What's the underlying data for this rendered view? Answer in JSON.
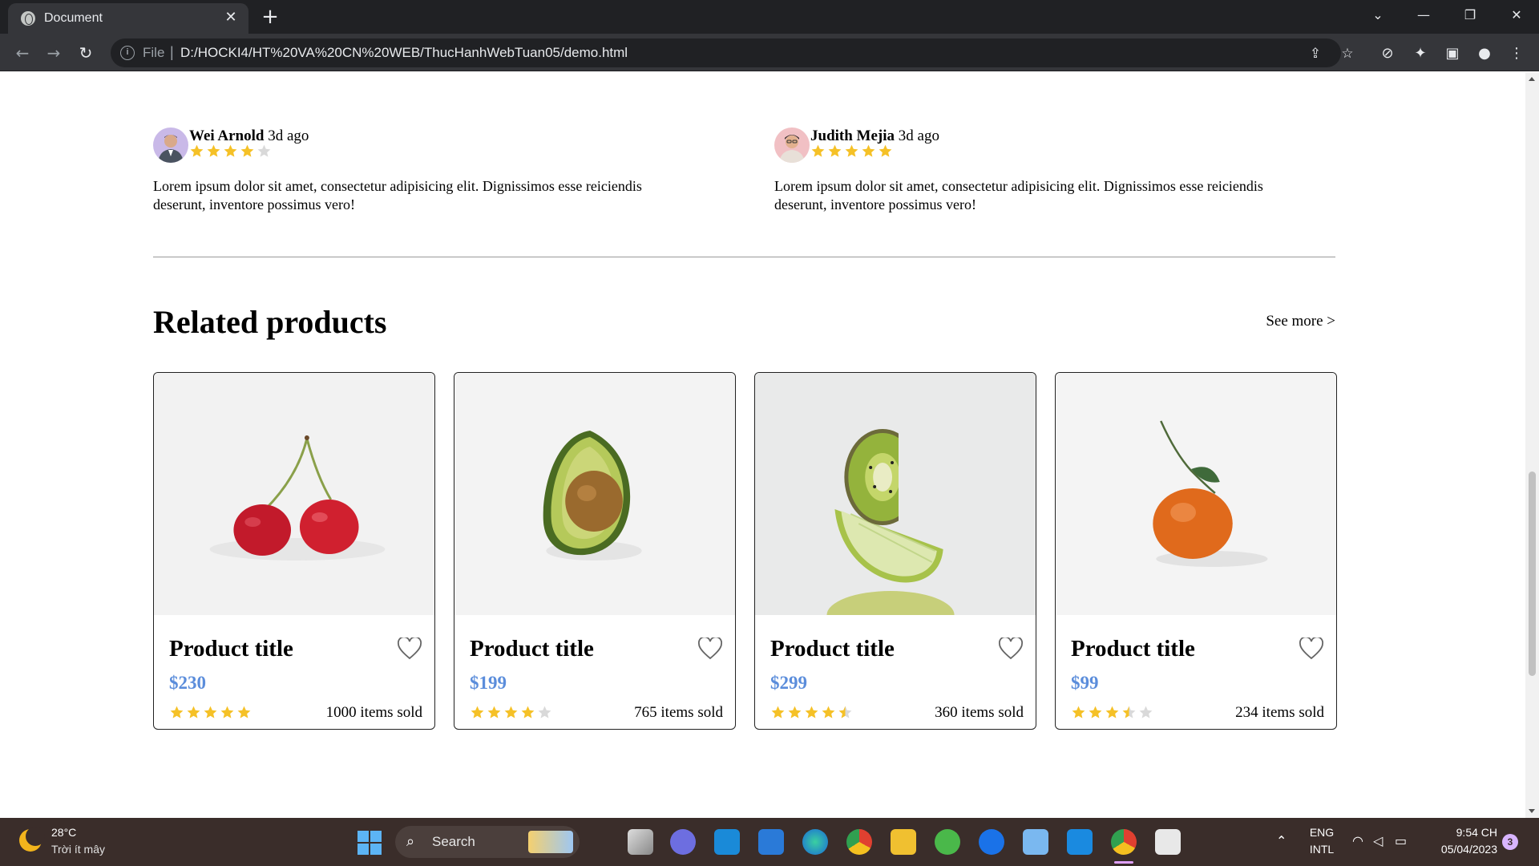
{
  "browser": {
    "tab_title": "Document",
    "tab_close": "✕",
    "new_tab": "+",
    "window_controls": [
      "⌄",
      "—",
      "❐",
      "✕"
    ],
    "nav": {
      "back": "←",
      "forward": "→",
      "reload": "↻"
    },
    "address": {
      "scheme": "File",
      "separator": "|",
      "url": "D:/HOCKI4/HT%20VA%20CN%20WEB/ThucHanhWebTuan05/demo.html",
      "info_icon": "i"
    },
    "toolbar_icons": [
      "share-icon",
      "bookmark-star-icon",
      "compass-icon",
      "extensions-icon",
      "side-panel-icon",
      "profile-icon",
      "menu-icon"
    ]
  },
  "reviews": [
    {
      "name": "Wei Arnold",
      "time": "3d ago",
      "rating": 4,
      "text": "Lorem ipsum dolor sit amet, consectetur adipisicing elit. Dignissimos esse reiciendis deserunt, inventore possimus vero!"
    },
    {
      "name": "Judith Mejia",
      "time": "3d ago",
      "rating": 5,
      "text": "Lorem ipsum dolor sit amet, consectetur adipisicing elit. Dignissimos esse reiciendis deserunt, inventore possimus vero!"
    }
  ],
  "related": {
    "title": "Related products",
    "see_more": "See more >",
    "products": [
      {
        "title": "Product title",
        "price": "$230",
        "rating": 5,
        "sold": "1000 items sold",
        "image": "cherries"
      },
      {
        "title": "Product title",
        "price": "$199",
        "rating": 4,
        "sold": "765 items sold",
        "image": "avocado"
      },
      {
        "title": "Product title",
        "price": "$299",
        "rating": 4.5,
        "sold": "360 items sold",
        "image": "kiwi-lime"
      },
      {
        "title": "Product title",
        "price": "$99",
        "rating": 3.5,
        "sold": "234 items sold",
        "image": "tangerine"
      }
    ]
  },
  "colors": {
    "star_filled": "#f5c127",
    "star_empty": "#d9d9d9",
    "price": "#5b8ddb"
  },
  "taskbar": {
    "weather_temp": "28°C",
    "weather_desc": "Trời ít mây",
    "search_label": "Search",
    "language_line1": "ENG",
    "language_line2": "INTL",
    "time": "9:54 CH",
    "date": "05/04/2023",
    "notification_count": "3",
    "apps": [
      "start-icon",
      "search",
      "widgets-icon",
      "file-explorer-icon",
      "teams-chat-icon",
      "app-l-icon",
      "mail-icon",
      "edge-icon",
      "chrome-icon",
      "folder-icon",
      "app-green-icon",
      "zalo-icon",
      "notepad-icon",
      "vscode-icon",
      "chrome-active-icon",
      "snipping-icon"
    ]
  }
}
